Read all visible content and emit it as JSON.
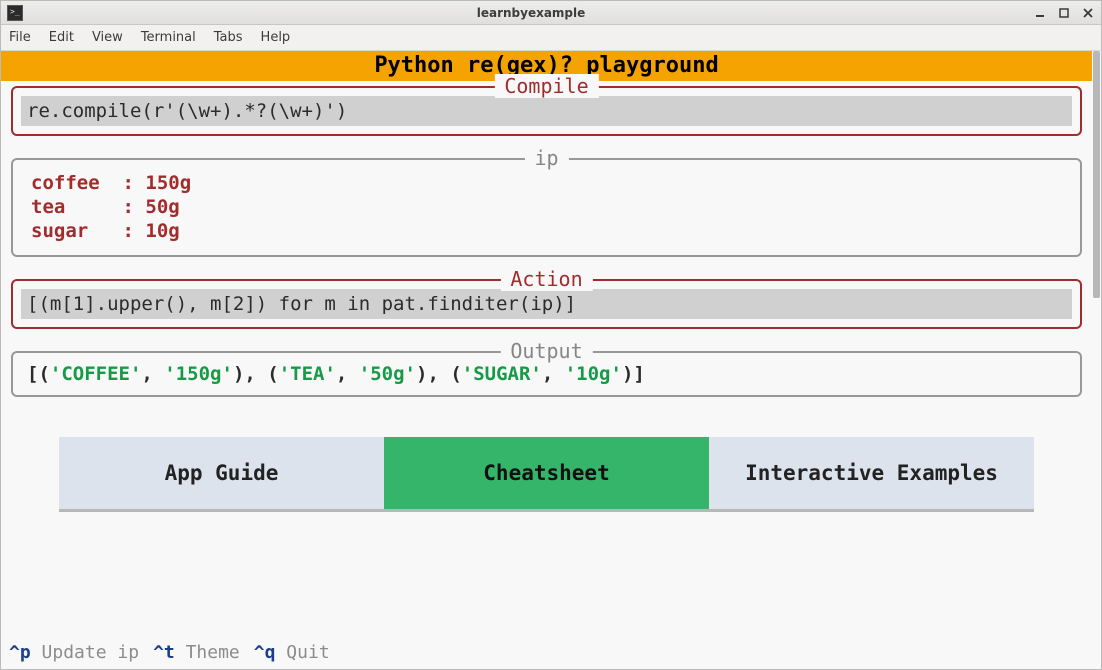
{
  "window": {
    "title": "learnbyexample"
  },
  "menu": {
    "items": [
      "File",
      "Edit",
      "View",
      "Terminal",
      "Tabs",
      "Help"
    ]
  },
  "app": {
    "title": "Python re(gex)? playground"
  },
  "panels": {
    "compile": {
      "label": "Compile",
      "value": "re.compile(r'(\\w+).*?(\\w+)')"
    },
    "ip": {
      "label": "ip",
      "body": "coffee  : 150g\ntea     : 50g\nsugar   : 10g"
    },
    "action": {
      "label": "Action",
      "value": "[(m[1].upper(), m[2]) for m in pat.finditer(ip)]"
    },
    "output": {
      "label": "Output",
      "prefix": "[(",
      "pairs": [
        {
          "a": "'COFFEE'",
          "b": "'150g'"
        },
        {
          "a": "'TEA'",
          "b": "'50g'"
        },
        {
          "a": "'SUGAR'",
          "b": "'10g'"
        }
      ],
      "sep_inner": ", ",
      "sep_outer": "), (",
      "suffix": ")]"
    }
  },
  "tabs": {
    "items": [
      {
        "label": "App Guide",
        "active": false
      },
      {
        "label": "Cheatsheet",
        "active": true
      },
      {
        "label": "Interactive Examples",
        "active": false
      }
    ]
  },
  "footer": [
    {
      "key": "^p",
      "label": "Update ip"
    },
    {
      "key": "^t",
      "label": "Theme"
    },
    {
      "key": "^q",
      "label": "Quit"
    }
  ]
}
